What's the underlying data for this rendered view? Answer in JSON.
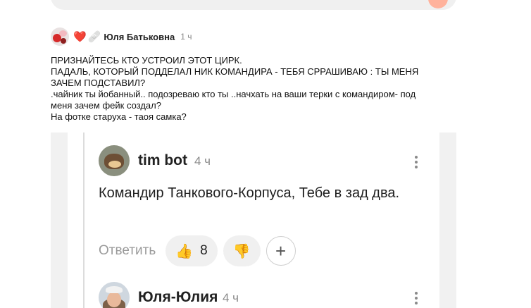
{
  "comment": {
    "badges": [
      "❤️",
      "🩹"
    ],
    "author": "Юля Батьковна",
    "time": "1 ч",
    "lines": [
      "ПРИЗНАЙТЕСЬ КТО УСТРОИЛ ЭТОТ ЦИРК.",
      "ПАДАЛЬ, КОТОРЫЙ ПОДДЕЛАЛ НИК КОМАНДИРА - ТЕБЯ СРРАШИВАЮ : ТЫ МЕНЯ",
      "ЗАЧЕМ ПОДСТАВИЛ?",
      ".чайник ты йобанный.. подозреваю кто ты ..начхать на ваши терки с командиром- под",
      "меня зачем фейк создал?",
      "На фотке старуха - таоя самка?"
    ]
  },
  "screenshot": {
    "reply1": {
      "author": "tim bot",
      "time": "4 ч",
      "text": "Командир Танкового-Корпуса, Тебе в зад два.",
      "reply_label": "Ответить",
      "like_count": "8",
      "like_icon": "👍",
      "dislike_icon": "👎",
      "plus": "+"
    },
    "reply2": {
      "author": "Юля-Юлия",
      "time": "4 ч"
    }
  }
}
